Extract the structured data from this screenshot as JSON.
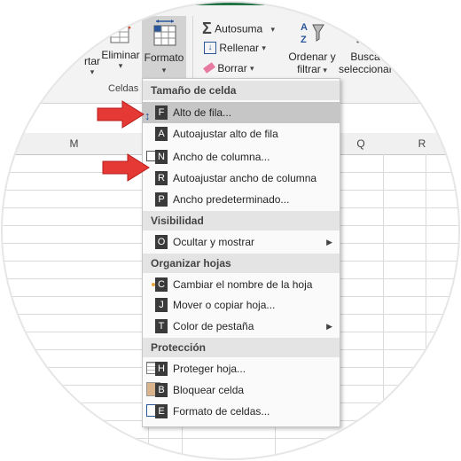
{
  "ribbon": {
    "insert_label": "rtar",
    "delete_label": "Eliminar",
    "format_label": "Formato",
    "cells_group_label": "Celdas",
    "autosum_label": "Autosuma",
    "fill_label": "Rellenar",
    "clear_label": "Borrar",
    "sort_label_1": "Ordenar y",
    "sort_label_2": "filtrar",
    "find_label_1": "Busca",
    "find_label_2": "seleccionar"
  },
  "sheet": {
    "columns": [
      "M",
      "Q",
      "R"
    ]
  },
  "menu": {
    "sections": {
      "cell_size": "Tamaño de celda",
      "visibility": "Visibilidad",
      "organize": "Organizar hojas",
      "protection": "Protección"
    },
    "items": [
      {
        "key": "F",
        "label": "Alto de fila..."
      },
      {
        "key": "A",
        "label": "Autoajustar alto de fila"
      },
      {
        "key": "N",
        "label": "Ancho de columna..."
      },
      {
        "key": "R",
        "label": "Autoajustar ancho de columna"
      },
      {
        "key": "P",
        "label": "Ancho predeterminado..."
      },
      {
        "key": "O",
        "label": "Ocultar y mostrar"
      },
      {
        "key": "C",
        "label": "Cambiar el nombre de la hoja"
      },
      {
        "key": "J",
        "label": "Mover o copiar hoja..."
      },
      {
        "key": "T",
        "label": "Color de pestaña"
      },
      {
        "key": "H",
        "label": "Proteger hoja..."
      },
      {
        "key": "B",
        "label": "Bloquear celda"
      },
      {
        "key": "E",
        "label": "Formato de celdas..."
      }
    ]
  },
  "colors": {
    "excel_green": "#217346",
    "highlight": "#c6c6c6",
    "arrow_red": "#e53935"
  }
}
